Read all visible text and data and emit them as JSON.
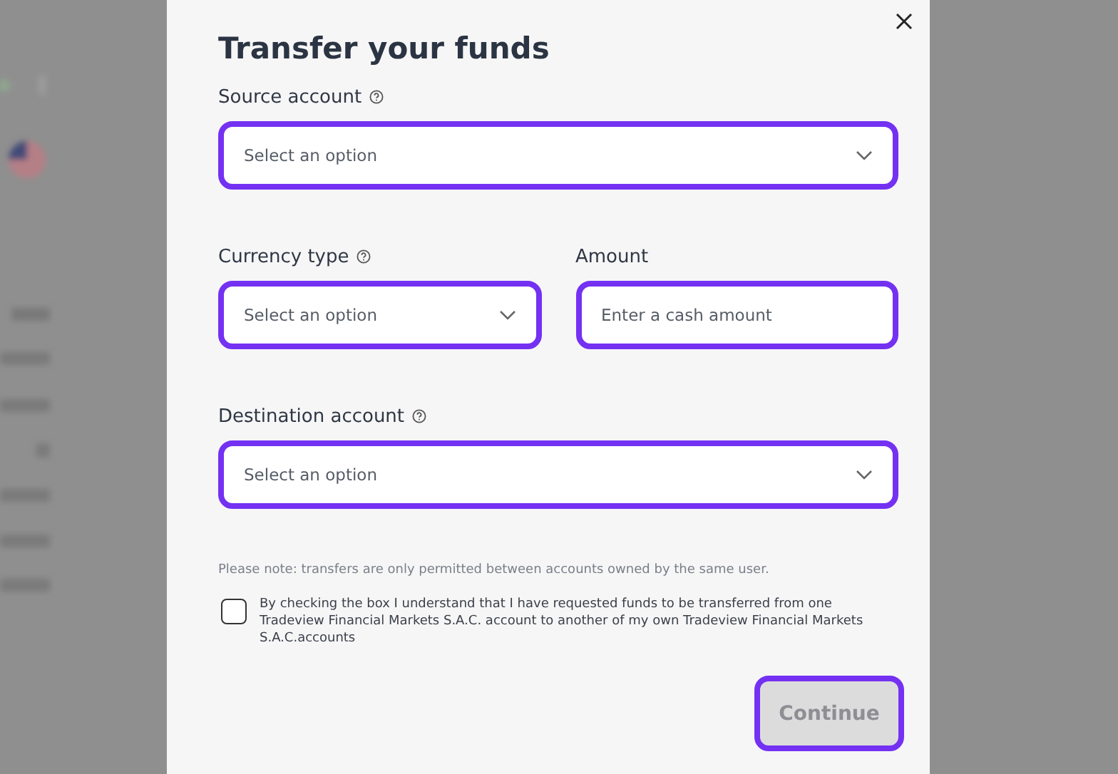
{
  "dialog": {
    "title": "Transfer your funds"
  },
  "rows": [
    [
      {
        "kind": "select",
        "label": "Source account",
        "help": true,
        "placeholder": "Select an option",
        "highlighted": true
      }
    ],
    [
      {
        "kind": "select",
        "label": "Currency type",
        "help": true,
        "placeholder": "Select an option",
        "highlighted": true
      },
      {
        "kind": "input",
        "label": "Amount",
        "help": false,
        "placeholder": "Enter a cash amount",
        "highlighted": true
      }
    ],
    [
      {
        "kind": "select",
        "label": "Destination account",
        "help": true,
        "placeholder": "Select an option",
        "highlighted": true
      }
    ]
  ],
  "note": "Please note: transfers are only permitted between accounts owned by the same user.",
  "agreement": {
    "text": "By checking the box I understand that I have requested funds to be transferred from one Tradeview Financial Markets S.A.C. account to another of my own Tradeview Financial Markets S.A.C.accounts",
    "checked": false
  },
  "continue_button": {
    "label": "Continue",
    "disabled": true,
    "highlighted": true
  }
}
